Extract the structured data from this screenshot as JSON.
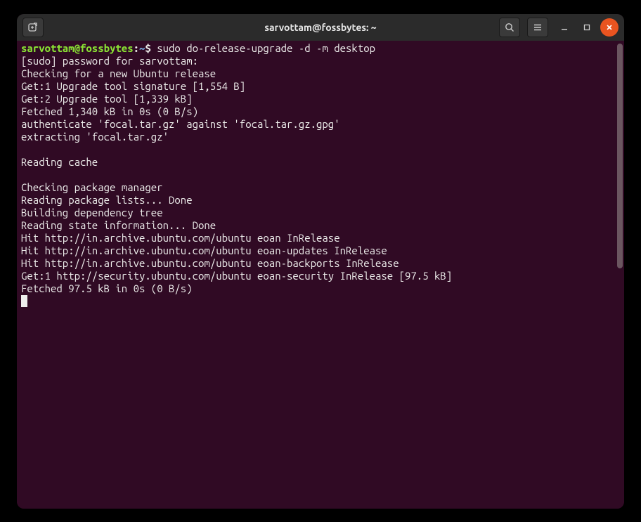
{
  "titlebar": {
    "title": "sarvottam@fossbytes: ~"
  },
  "prompt": {
    "user_host": "sarvottam@fossbytes",
    "separator": ":",
    "path": "~",
    "dollar": "$ ",
    "command": "sudo do-release-upgrade -d -m desktop"
  },
  "output_lines": [
    "[sudo] password for sarvottam: ",
    "Checking for a new Ubuntu release",
    "Get:1 Upgrade tool signature [1,554 B]",
    "Get:2 Upgrade tool [1,339 kB]",
    "Fetched 1,340 kB in 0s (0 B/s)",
    "authenticate 'focal.tar.gz' against 'focal.tar.gz.gpg'",
    "extracting 'focal.tar.gz'",
    "",
    "Reading cache",
    "",
    "Checking package manager",
    "Reading package lists... Done",
    "Building dependency tree",
    "Reading state information... Done",
    "Hit http://in.archive.ubuntu.com/ubuntu eoan InRelease",
    "Hit http://in.archive.ubuntu.com/ubuntu eoan-updates InRelease",
    "Hit http://in.archive.ubuntu.com/ubuntu eoan-backports InRelease",
    "Get:1 http://security.ubuntu.com/ubuntu eoan-security InRelease [97.5 kB]",
    "Fetched 97.5 kB in 0s (0 B/s)"
  ]
}
